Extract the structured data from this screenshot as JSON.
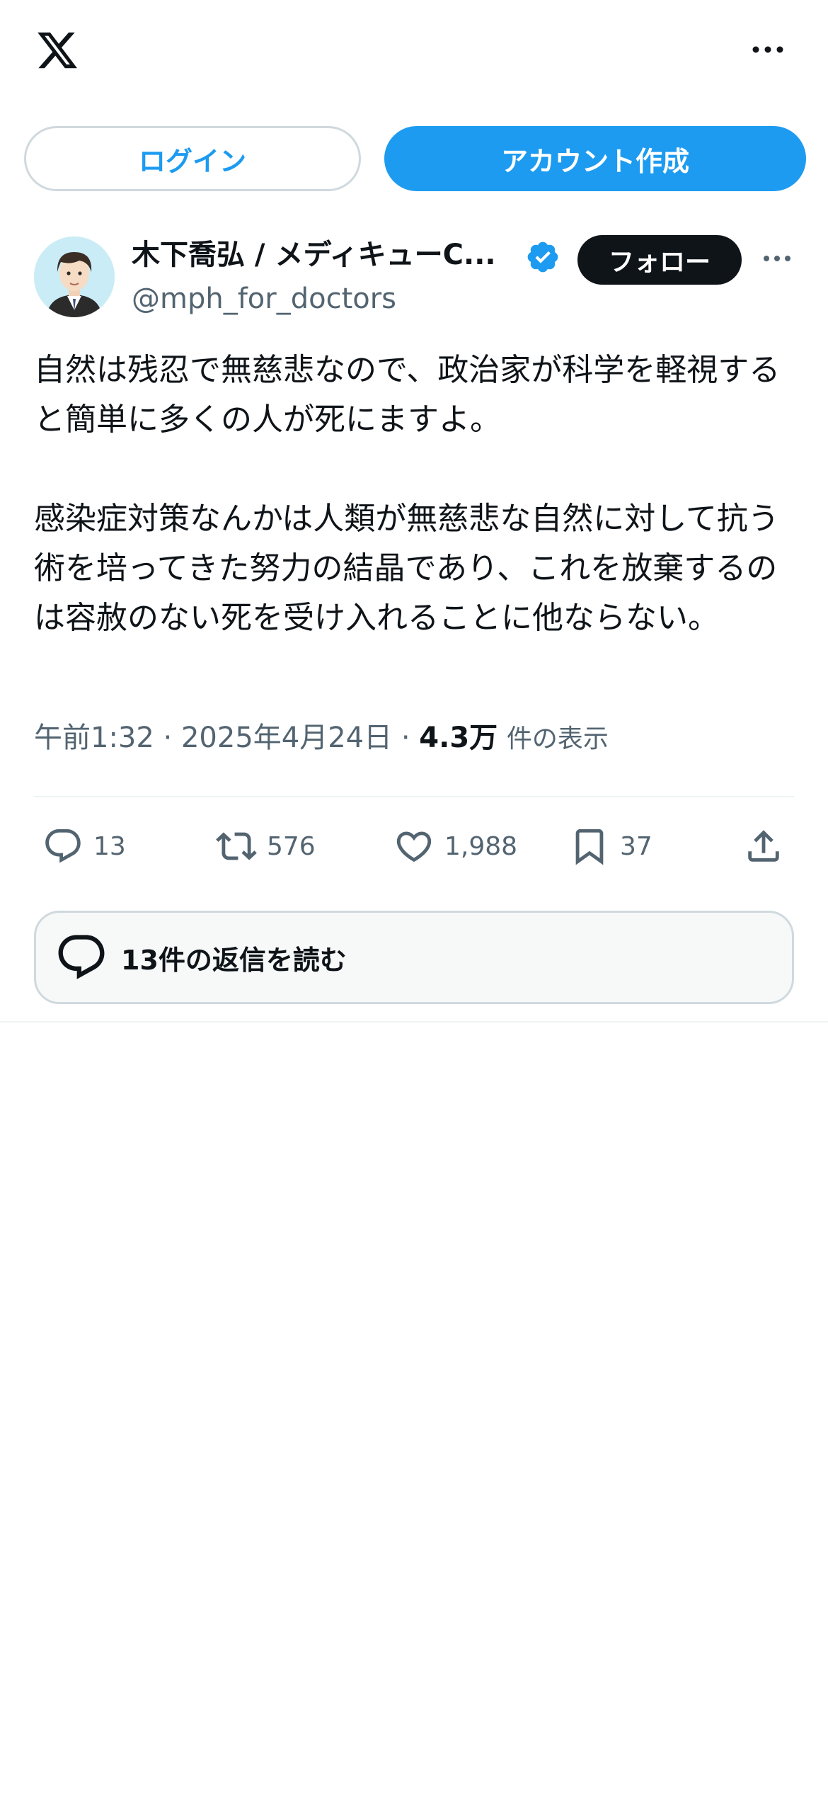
{
  "header": {
    "logo_icon": "x-logo-icon",
    "more_icon": "more-horizontal-icon"
  },
  "auth": {
    "login_label": "ログイン",
    "signup_label": "アカウント作成",
    "accent_color": "#1d9bf0"
  },
  "post": {
    "display_name": "木下喬弘 / メディキューC...",
    "handle": "@mph_for_doctors",
    "verified_icon": "verified-badge-icon",
    "follow_label": "フォロー",
    "text": "自然は残忍で無慈悲なので、政治家が科学を軽視すると簡単に多くの人が死にますよ。\n\n感染症対策なんかは人類が無慈悲な自然に対して抗う術を培ってきた努力の結晶であり、これを放棄するのは容赦のない死を受け入れることに他ならない。",
    "time": "午前1:32",
    "date": "2025年4月24日",
    "separator": "·",
    "views_count": "4.3万",
    "views_label": "件の表示"
  },
  "actions": {
    "replies": "13",
    "reposts": "576",
    "likes": "1,988",
    "bookmarks": "37"
  },
  "read_replies": {
    "label": "13件の返信を読む"
  }
}
